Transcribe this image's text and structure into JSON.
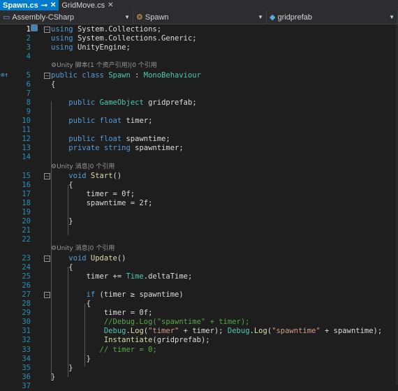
{
  "tabs": [
    {
      "label": "Spawn.cs",
      "active": true,
      "pin": "⊸",
      "close": "✕"
    },
    {
      "label": "GridMove.cs",
      "active": false,
      "close": "✕"
    }
  ],
  "nav": {
    "project": "Assembly-CSharp",
    "class": "Spawn",
    "member": "gridprefab"
  },
  "lines": [
    {
      "n": "1",
      "toks": [
        [
          "kw",
          "using "
        ],
        [
          "pl",
          "System.Collections;"
        ]
      ]
    },
    {
      "n": "2",
      "toks": [
        [
          "kw",
          "using "
        ],
        [
          "pl",
          "System.Collections.Generic;"
        ]
      ]
    },
    {
      "n": "3",
      "toks": [
        [
          "kw",
          "using "
        ],
        [
          "pl",
          "UnityEngine;"
        ]
      ]
    },
    {
      "n": "4",
      "toks": []
    },
    {
      "n": "",
      "lens": "⚙Unity 脚本(1 个资产引用)|0 个引用"
    },
    {
      "n": "5",
      "toks": [
        [
          "kw",
          "public class "
        ],
        [
          "ty",
          "Spawn"
        ],
        [
          "pl",
          " : "
        ],
        [
          "ty",
          "MonoBehaviour"
        ]
      ]
    },
    {
      "n": "6",
      "toks": [
        [
          "pl",
          "{"
        ]
      ]
    },
    {
      "n": "7",
      "toks": []
    },
    {
      "n": "8",
      "toks": [
        [
          "pl",
          "    "
        ],
        [
          "kw",
          "public "
        ],
        [
          "ty",
          "GameObject"
        ],
        [
          "pl",
          " gridprefab;"
        ]
      ]
    },
    {
      "n": "9",
      "toks": []
    },
    {
      "n": "10",
      "toks": [
        [
          "pl",
          "    "
        ],
        [
          "kw",
          "public float "
        ],
        [
          "pl",
          "timer;"
        ]
      ]
    },
    {
      "n": "11",
      "toks": []
    },
    {
      "n": "12",
      "toks": [
        [
          "pl",
          "    "
        ],
        [
          "kw",
          "public float "
        ],
        [
          "pl",
          "spawntime;"
        ]
      ]
    },
    {
      "n": "13",
      "toks": [
        [
          "pl",
          "    "
        ],
        [
          "kw",
          "private string "
        ],
        [
          "pl",
          "spawntimer;"
        ]
      ]
    },
    {
      "n": "14",
      "toks": []
    },
    {
      "n": "",
      "lens": "⚙Unity 消息|0 个引用"
    },
    {
      "n": "15",
      "toks": [
        [
          "pl",
          "    "
        ],
        [
          "kw",
          "void "
        ],
        [
          "mt",
          "Start"
        ],
        [
          "pl",
          "()"
        ]
      ]
    },
    {
      "n": "16",
      "toks": [
        [
          "pl",
          "    {"
        ]
      ]
    },
    {
      "n": "17",
      "toks": [
        [
          "pl",
          "        timer = 0f;"
        ]
      ]
    },
    {
      "n": "18",
      "toks": [
        [
          "pl",
          "        spawntime = 2f;"
        ]
      ]
    },
    {
      "n": "19",
      "toks": []
    },
    {
      "n": "20",
      "toks": [
        [
          "pl",
          "    }"
        ]
      ]
    },
    {
      "n": "21",
      "toks": []
    },
    {
      "n": "22",
      "toks": []
    },
    {
      "n": "",
      "lens": "⚙Unity 消息|0 个引用"
    },
    {
      "n": "23",
      "toks": [
        [
          "pl",
          "    "
        ],
        [
          "kw",
          "void "
        ],
        [
          "mt",
          "Update"
        ],
        [
          "pl",
          "()"
        ]
      ]
    },
    {
      "n": "24",
      "toks": [
        [
          "pl",
          "    {"
        ]
      ]
    },
    {
      "n": "25",
      "toks": [
        [
          "pl",
          "        timer += "
        ],
        [
          "ty",
          "Time"
        ],
        [
          "pl",
          ".deltaTime;"
        ]
      ]
    },
    {
      "n": "26",
      "toks": []
    },
    {
      "n": "27",
      "toks": [
        [
          "pl",
          "        "
        ],
        [
          "kw",
          "if "
        ],
        [
          "pl",
          "(timer ≥ spawntime)"
        ]
      ]
    },
    {
      "n": "28",
      "toks": [
        [
          "pl",
          "        {"
        ]
      ]
    },
    {
      "n": "29",
      "toks": [
        [
          "pl",
          "            timer = 0f;"
        ]
      ]
    },
    {
      "n": "30",
      "toks": [
        [
          "pl",
          "            "
        ],
        [
          "cm",
          "//Debug.Log(\"spawntime\" + timer);"
        ]
      ]
    },
    {
      "n": "31",
      "toks": [
        [
          "pl",
          "            "
        ],
        [
          "ty",
          "Debug"
        ],
        [
          "pl",
          "."
        ],
        [
          "mt",
          "Log"
        ],
        [
          "pl",
          "("
        ],
        [
          "st",
          "\"timer\""
        ],
        [
          "pl",
          " + timer); "
        ],
        [
          "ty",
          "Debug"
        ],
        [
          "pl",
          "."
        ],
        [
          "mt",
          "Log"
        ],
        [
          "pl",
          "("
        ],
        [
          "st",
          "\"spawntime\""
        ],
        [
          "pl",
          " + spawntime);"
        ]
      ]
    },
    {
      "n": "32",
      "toks": [
        [
          "pl",
          "            "
        ],
        [
          "mt",
          "Instantiate"
        ],
        [
          "pl",
          "(gridprefab);"
        ]
      ]
    },
    {
      "n": "33",
      "toks": [
        [
          "pl",
          "           "
        ],
        [
          "cm",
          "// timer = 0;"
        ]
      ]
    },
    {
      "n": "34",
      "toks": [
        [
          "pl",
          "        }"
        ]
      ]
    },
    {
      "n": "35",
      "toks": [
        [
          "pl",
          "    }"
        ]
      ]
    },
    {
      "n": "36",
      "toks": [
        [
          "pl",
          "}"
        ]
      ]
    },
    {
      "n": "37",
      "toks": []
    }
  ]
}
